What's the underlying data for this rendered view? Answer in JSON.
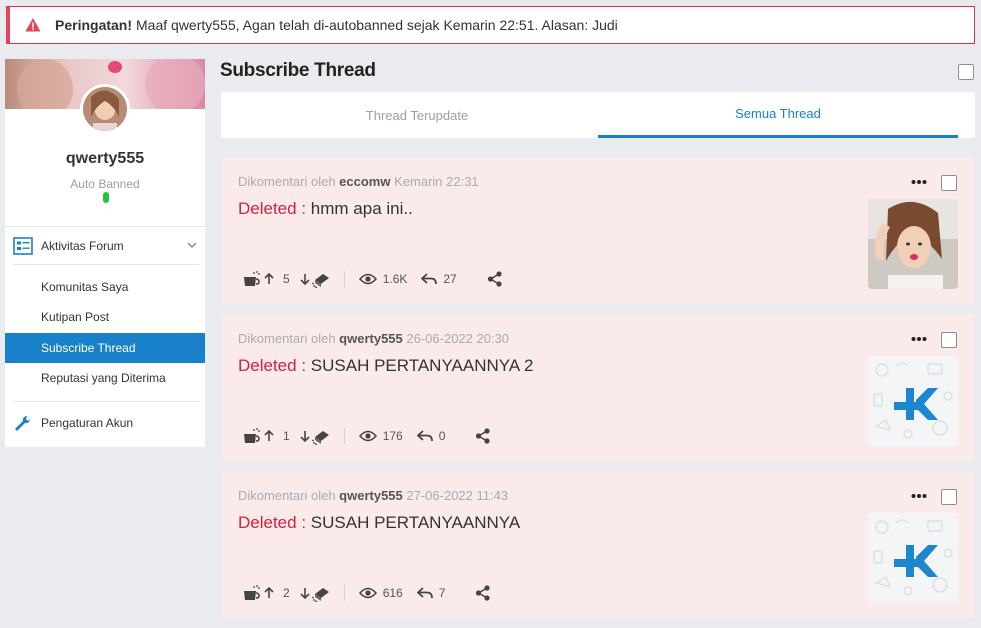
{
  "alert": {
    "strong": "Peringatan!",
    "message": "Maaf qwerty555, Agan telah di-autobanned sejak Kemarin 22:51. Alasan: Judi"
  },
  "profile": {
    "username": "qwerty555",
    "status": "Auto Banned"
  },
  "sidebar": {
    "section_label": "Aktivitas Forum",
    "items": [
      {
        "label": "Komunitas Saya"
      },
      {
        "label": "Kutipan Post"
      },
      {
        "label": "Subscribe Thread"
      },
      {
        "label": "Reputasi yang Diterima"
      }
    ],
    "settings_label": "Pengaturan Akun"
  },
  "page": {
    "title": "Subscribe Thread",
    "tabs": [
      {
        "label": "Thread Terupdate"
      },
      {
        "label": "Semua Thread"
      }
    ]
  },
  "threads": [
    {
      "prefix": "Dikomentari oleh",
      "user": "eccomw",
      "time": "Kemarin 22:31",
      "deleted": "Deleted :",
      "text": "hmm apa ini..",
      "votes": "5",
      "views": "1.6K",
      "replies": "27",
      "thumb": "photo"
    },
    {
      "prefix": "Dikomentari oleh",
      "user": "qwerty555",
      "time": "26-06-2022 20:30",
      "deleted": "Deleted :",
      "text": "SUSAH PERTANYAANNYA 2",
      "votes": "1",
      "views": "176",
      "replies": "0",
      "thumb": "kaskus-logo"
    },
    {
      "prefix": "Dikomentari oleh",
      "user": "qwerty555",
      "time": "27-06-2022 11:43",
      "deleted": "Deleted :",
      "text": "SUSAH PERTANYAANNYA",
      "votes": "2",
      "views": "616",
      "replies": "7",
      "thumb": "kaskus-logo"
    }
  ],
  "colors": {
    "accent": "#1981c9",
    "alert_red": "#e5435a",
    "card_bg": "#fbeaea",
    "deleted_red": "#d0213f",
    "online_green": "#22c33b"
  }
}
